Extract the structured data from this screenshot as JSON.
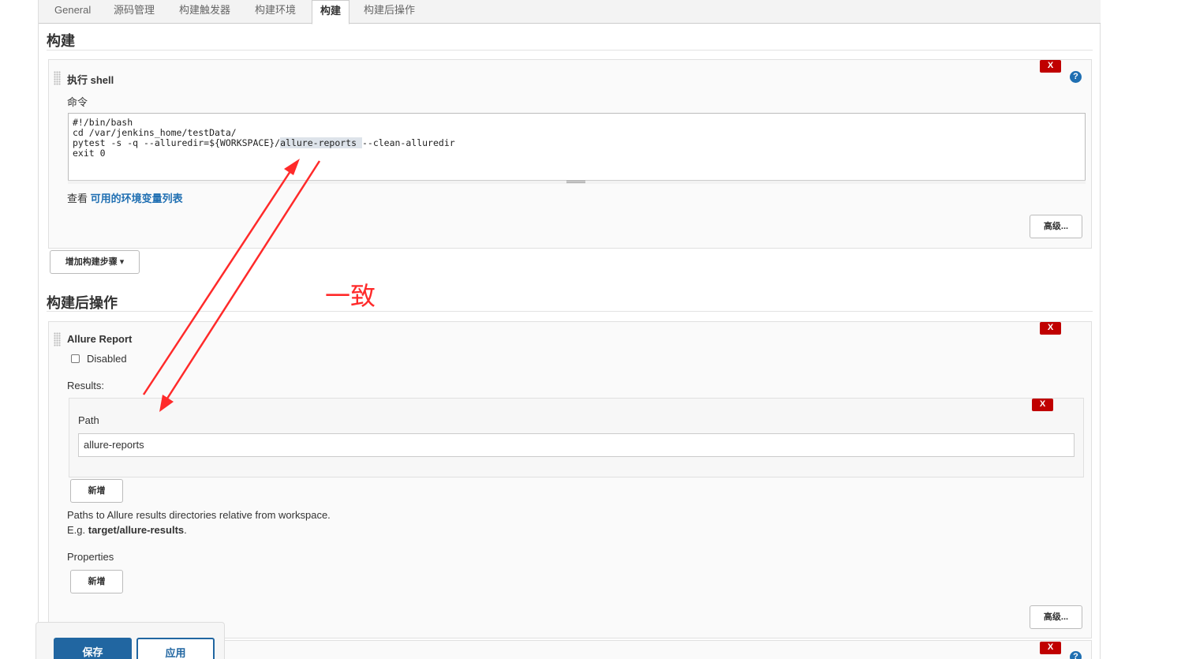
{
  "tabs": [
    "General",
    "源码管理",
    "构建触发器",
    "构建环境",
    "构建",
    "构建后操作"
  ],
  "active_tab": "构建",
  "build_section": {
    "title": "构建",
    "step": {
      "title": "执行 shell",
      "command_label": "命令",
      "command_lines": {
        "line1": "#!/bin/bash",
        "line2": "cd /var/jenkins_home/testData/",
        "line3_prefix": "pytest -s -q --alluredir=${WORKSPACE}/",
        "line3_highlight": "allure-reports ",
        "line3_suffix": "--clean-alluredir",
        "line4": "exit 0"
      },
      "env_prefix": "查看 ",
      "env_link": "可用的环境变量列表",
      "advanced_label": "高级...",
      "delete_label": "X",
      "help_label": "?"
    },
    "add_step_label": "增加构建步骤"
  },
  "post_build_section": {
    "title": "构建后操作",
    "allure": {
      "title": "Allure Report",
      "disabled_label": "Disabled",
      "results_label": "Results:",
      "path_label": "Path",
      "path_value": "allure-reports",
      "add_label": "新增",
      "hint_line1": "Paths to Allure results directories relative from workspace.",
      "hint_eg": "E.g. ",
      "hint_example": "target/allure-results",
      "hint_period": ".",
      "properties_label": "Properties",
      "properties_add_label": "新增",
      "advanced_label": "高级...",
      "delete_label": "X"
    }
  },
  "annotation": "一致",
  "footer": {
    "save_label": "保存",
    "apply_label": "应用"
  },
  "colors": {
    "accent": "#2166a1",
    "danger": "#c00000",
    "annotation": "#ff2a2a",
    "link": "#1f6fb2"
  }
}
